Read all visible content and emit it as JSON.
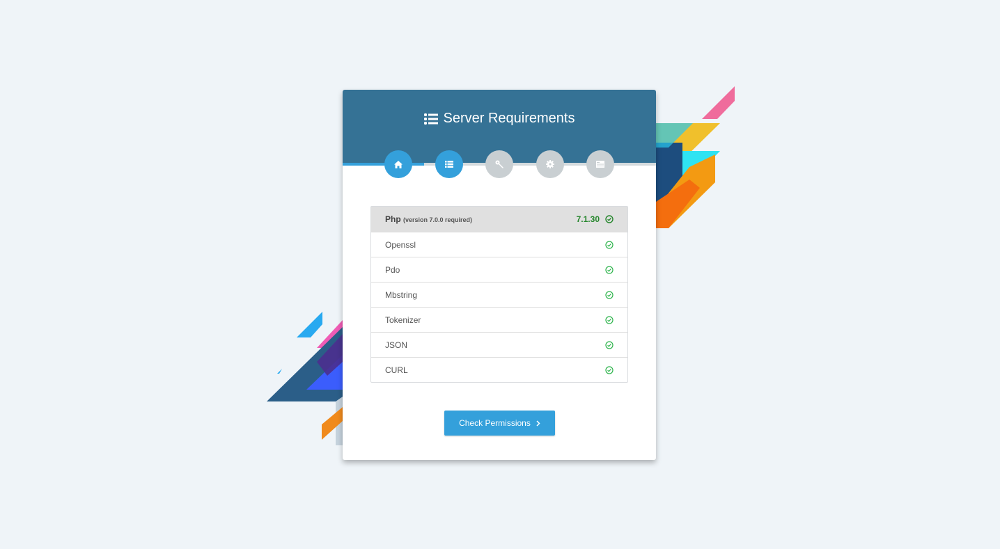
{
  "header": {
    "title": "Server Requirements",
    "title_icon": "list-icon"
  },
  "steps": [
    {
      "name": "welcome",
      "icon": "home-icon",
      "state": "done"
    },
    {
      "name": "requirements",
      "icon": "list-icon",
      "state": "active"
    },
    {
      "name": "permissions",
      "icon": "key-icon",
      "state": "pending"
    },
    {
      "name": "environment",
      "icon": "gear-icon",
      "state": "pending"
    },
    {
      "name": "final",
      "icon": "server-icon",
      "state": "pending"
    }
  ],
  "requirements": {
    "php": {
      "label": "Php",
      "note": "(version 7.0.0 required)",
      "version": "7.1.30",
      "status": "ok"
    },
    "extensions": [
      {
        "label": "Openssl",
        "status": "ok"
      },
      {
        "label": "Pdo",
        "status": "ok"
      },
      {
        "label": "Mbstring",
        "status": "ok"
      },
      {
        "label": "Tokenizer",
        "status": "ok"
      },
      {
        "label": "JSON",
        "status": "ok"
      },
      {
        "label": "CURL",
        "status": "ok"
      }
    ]
  },
  "actions": {
    "next_label": "Check Permissions"
  },
  "colors": {
    "header": "#357295",
    "accent": "#34a0db",
    "ok_green": "#25862c",
    "check_green": "#2cb34a",
    "step_inactive": "#c9cfd2",
    "background": "#eff4f8"
  }
}
